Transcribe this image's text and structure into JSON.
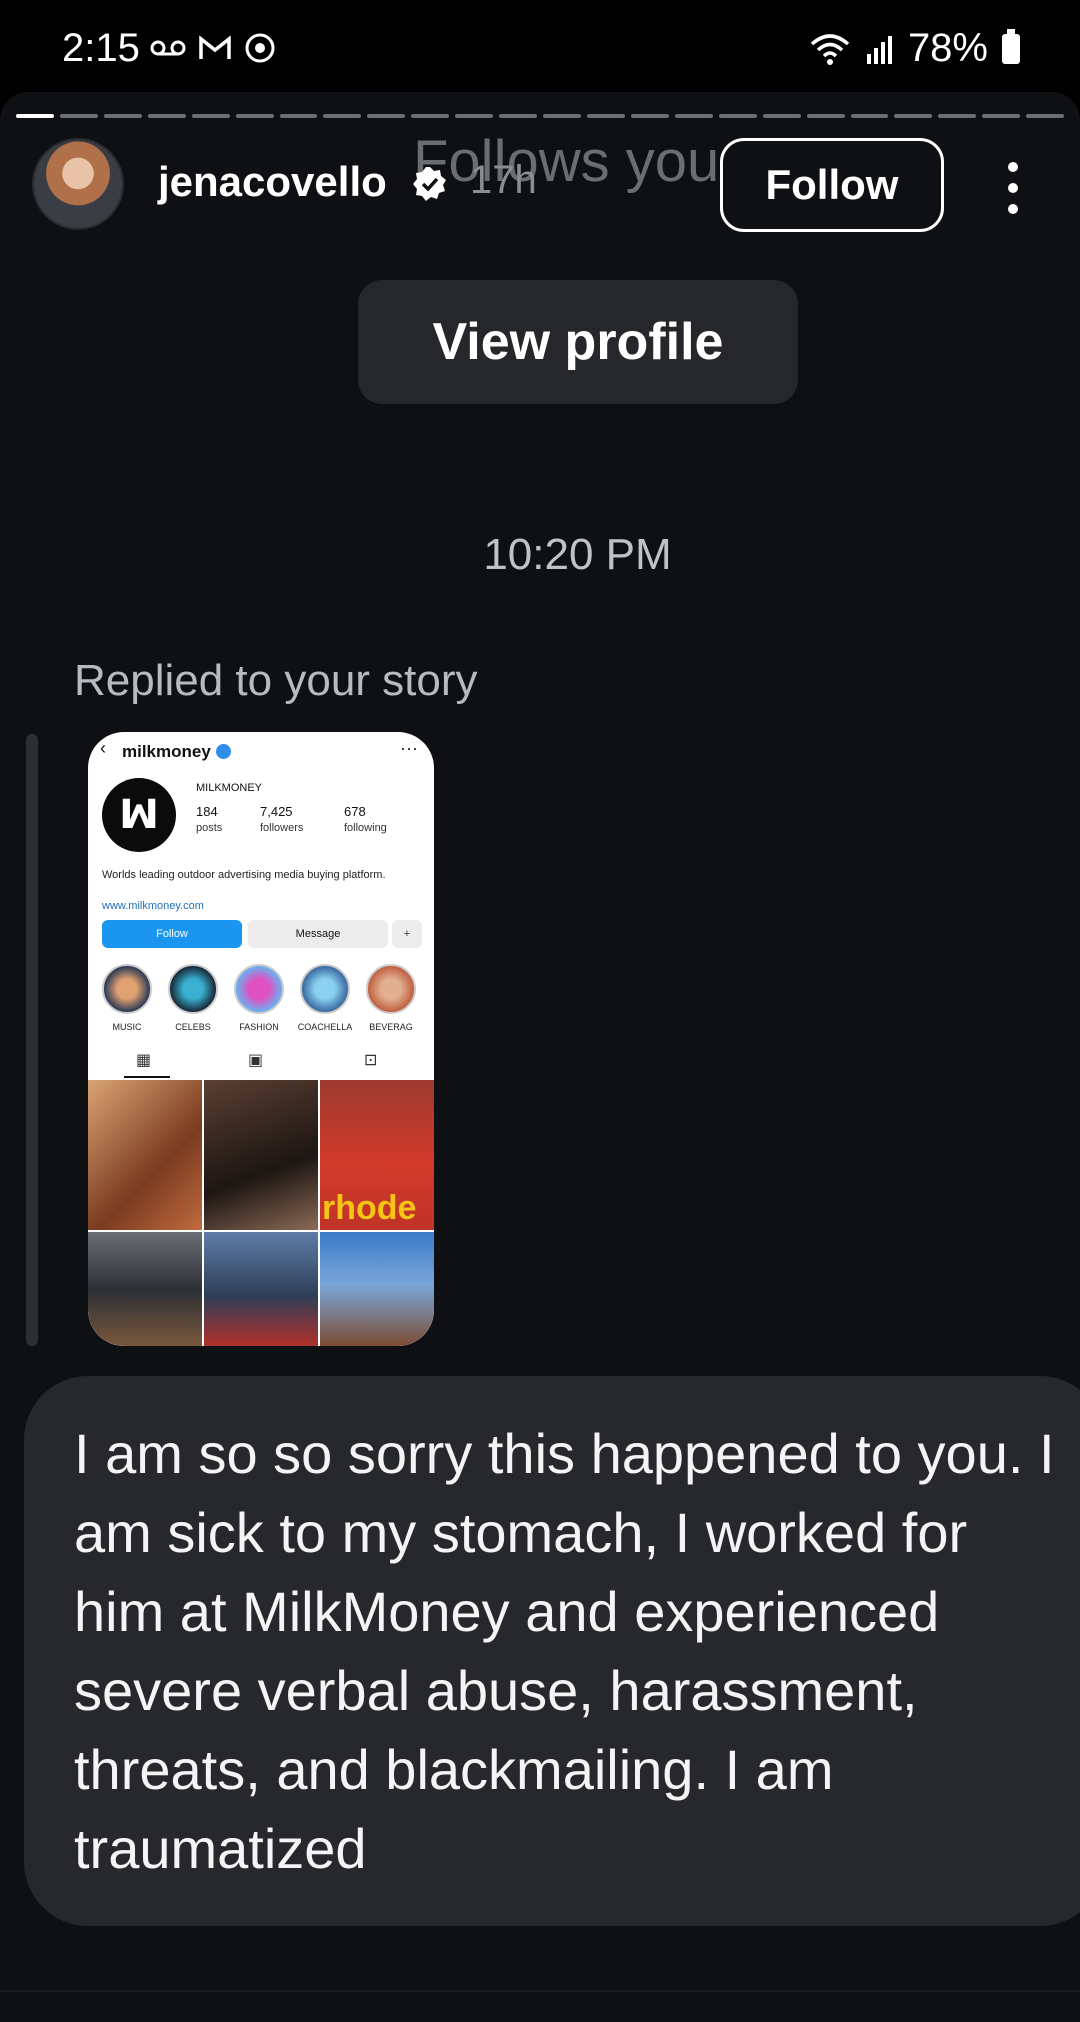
{
  "status_bar": {
    "time": "2:15",
    "battery": "78%",
    "left_icons": [
      "voicemail-icon",
      "gmail-icon",
      "instagram-icon"
    ],
    "right_icons": [
      "wifi-icon",
      "signal-icon",
      "battery-icon"
    ]
  },
  "ghost": {
    "follows_you": "Follows you"
  },
  "header": {
    "username": "jenacovello",
    "time_ago": "17h",
    "follow_label": "Follow"
  },
  "view_profile_label": "View profile",
  "message_time": "10:20 PM",
  "replied_label": "Replied to your story",
  "story": {
    "handle": "milkmoney",
    "display_name": "MILKMONEY",
    "stats": [
      {
        "value": "184",
        "label": "posts"
      },
      {
        "value": "7,425",
        "label": "followers"
      },
      {
        "value": "678",
        "label": "following"
      }
    ],
    "bio": "Worlds leading outdoor advertising media buying platform.",
    "link": "www.milkmoney.com",
    "follow_label": "Follow",
    "message_label": "Message",
    "highlights": [
      "MUSIC",
      "CELEBS",
      "FASHION",
      "COACHELLA",
      "BEVERAG"
    ],
    "grid_text": "rhode"
  },
  "message": {
    "text": "I am so so sorry this happened to you. I am sick to my stomach, I worked for him at MilkMoney and experienced severe verbal abuse, harassment, threats, and blackmailing. I am traumatized"
  },
  "colors": {
    "background": "#0e1013",
    "bubble": "#26282c",
    "button": "#25272b",
    "accent_blue": "#1a96f0"
  }
}
